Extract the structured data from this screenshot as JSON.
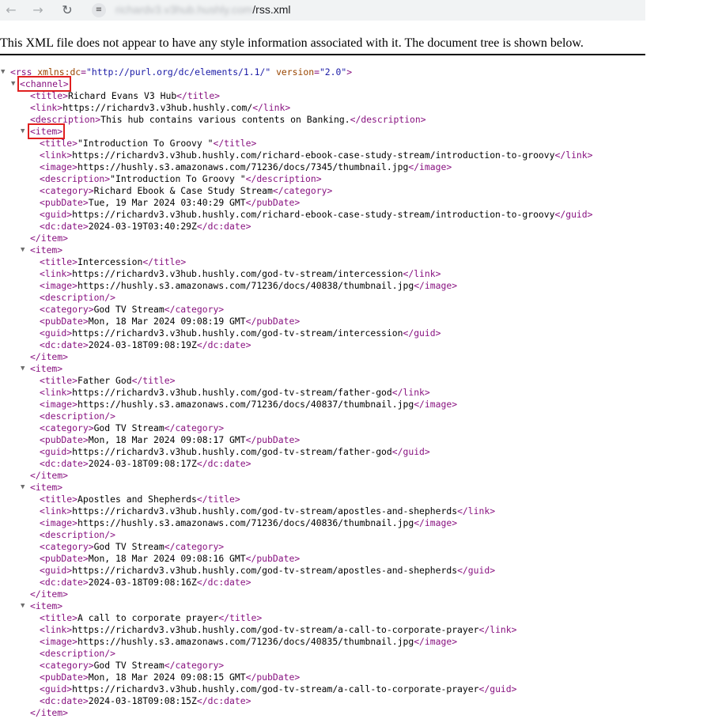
{
  "browser": {
    "back_icon": "arrow-left-icon",
    "forward_icon": "arrow-right-icon",
    "reload_icon": "reload-icon",
    "site_info_icon": "tune-icon",
    "url_host_blurred": "richardv3.v3hub.hushly.com",
    "url_path": "/rss.xml"
  },
  "notice": "This XML file does not appear to have any style information associated with it. The document tree is shown below.",
  "xml": {
    "rss_open_tag": "<rss",
    "rss_attr1_name": "xmlns:dc",
    "rss_attr1_value": "\"http://purl.org/dc/elements/1.1/\"",
    "rss_attr2_name": "version",
    "rss_attr2_value": "\"2.0\"",
    "channel_open": "<channel>",
    "channel_title": "Richard Evans V3 Hub",
    "channel_link": "https://richardv3.v3hub.hushly.com/",
    "channel_description": "This hub contains various contents on Banking.",
    "items": [
      {
        "title": "\"Introduction To Groovy \"",
        "link": "https://richardv3.v3hub.hushly.com/richard-ebook-case-study-stream/introduction-to-groovy",
        "image": "https://hushly.s3.amazonaws.com/71236/docs/7345/thumbnail.jpg",
        "description": "\"Introduction To Groovy \"",
        "category": "Richard Ebook & Case Study Stream",
        "pubDate": "Tue, 19 Mar 2024 03:40:29 GMT",
        "guid": "https://richardv3.v3hub.hushly.com/richard-ebook-case-study-stream/introduction-to-groovy",
        "dcdate": "2024-03-19T03:40:29Z"
      },
      {
        "title": "Intercession",
        "link": "https://richardv3.v3hub.hushly.com/god-tv-stream/intercession",
        "image": "https://hushly.s3.amazonaws.com/71236/docs/40838/thumbnail.jpg",
        "description": "",
        "category": "God TV Stream",
        "pubDate": "Mon, 18 Mar 2024 09:08:19 GMT",
        "guid": "https://richardv3.v3hub.hushly.com/god-tv-stream/intercession",
        "dcdate": "2024-03-18T09:08:19Z"
      },
      {
        "title": "Father God",
        "link": "https://richardv3.v3hub.hushly.com/god-tv-stream/father-god",
        "image": "https://hushly.s3.amazonaws.com/71236/docs/40837/thumbnail.jpg",
        "description": "",
        "category": "God TV Stream",
        "pubDate": "Mon, 18 Mar 2024 09:08:17 GMT",
        "guid": "https://richardv3.v3hub.hushly.com/god-tv-stream/father-god",
        "dcdate": "2024-03-18T09:08:17Z"
      },
      {
        "title": "Apostles and Shepherds",
        "link": "https://richardv3.v3hub.hushly.com/god-tv-stream/apostles-and-shepherds",
        "image": "https://hushly.s3.amazonaws.com/71236/docs/40836/thumbnail.jpg",
        "description": "",
        "category": "God TV Stream",
        "pubDate": "Mon, 18 Mar 2024 09:08:16 GMT",
        "guid": "https://richardv3.v3hub.hushly.com/god-tv-stream/apostles-and-shepherds",
        "dcdate": "2024-03-18T09:08:16Z"
      },
      {
        "title": "A call to corporate prayer",
        "link": "https://richardv3.v3hub.hushly.com/god-tv-stream/a-call-to-corporate-prayer",
        "image": "https://hushly.s3.amazonaws.com/71236/docs/40835/thumbnail.jpg",
        "description": "",
        "category": "God TV Stream",
        "pubDate": "Mon, 18 Mar 2024 09:08:15 GMT",
        "guid": "https://richardv3.v3hub.hushly.com/god-tv-stream/a-call-to-corporate-prayer",
        "dcdate": "2024-03-18T09:08:15Z"
      }
    ]
  },
  "colors": {
    "tag": "#881280",
    "attr_name": "#994500",
    "attr_value": "#1a1aa6",
    "highlight_box": "#e02020"
  }
}
